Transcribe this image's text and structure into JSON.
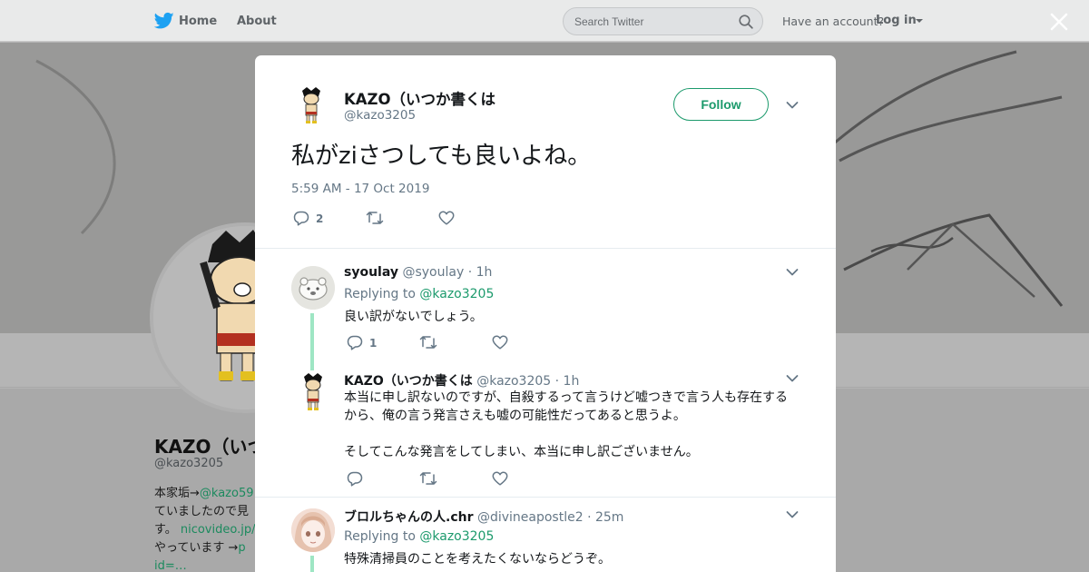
{
  "nav": {
    "home": "Home",
    "about": "About",
    "search_placeholder": "Search Twitter",
    "have_account": "Have an account?",
    "login": "Log in"
  },
  "profile": {
    "name": "KAZO（いつ",
    "handle": "@kazo3205",
    "bio_lines": [
      "本家垢→",
      "@kazo59",
      "ていましたので見",
      "す。",
      "nicovideo.jp/",
      "やっています →",
      "p",
      "id=…"
    ]
  },
  "tweet": {
    "name": "KAZO（いつか書くは",
    "handle": "@kazo3205",
    "follow_label": "Follow",
    "text": "私がziさつしても良いよね。",
    "time": "5:59 AM - 17 Oct 2019",
    "reply_count": "2"
  },
  "replies": [
    {
      "name": "syoulay",
      "handle": "@syoulay",
      "time": "· 1h",
      "replying_label": "Replying to",
      "replying_to": "@kazo3205",
      "text": "良い訳がないでしょう。",
      "reply_count": "1"
    },
    {
      "name": "KAZO（いつか書くは",
      "handle": "@kazo3205",
      "time": "· 1h",
      "text_line1": "本当に申し訳ないのですが、自殺するって言うけど嘘つきで言う人も存在する",
      "text_line2": "から、俺の言う発言さえも嘘の可能性だってあると思うよ。",
      "text_line3": "そしてこんな発言をしてしまい、本当に申し訳ございません。"
    },
    {
      "name": "ブロルちゃんの人.chr",
      "handle": "@divineapostle2",
      "time": "· 25m",
      "replying_label": "Replying to",
      "replying_to": "@kazo3205",
      "text": "特殊清掃員のことを考えたくないならどうぞ。"
    }
  ],
  "colors": {
    "accent": "#1c9a6c",
    "thread_line": "#9ee6c4",
    "muted": "#657786"
  }
}
